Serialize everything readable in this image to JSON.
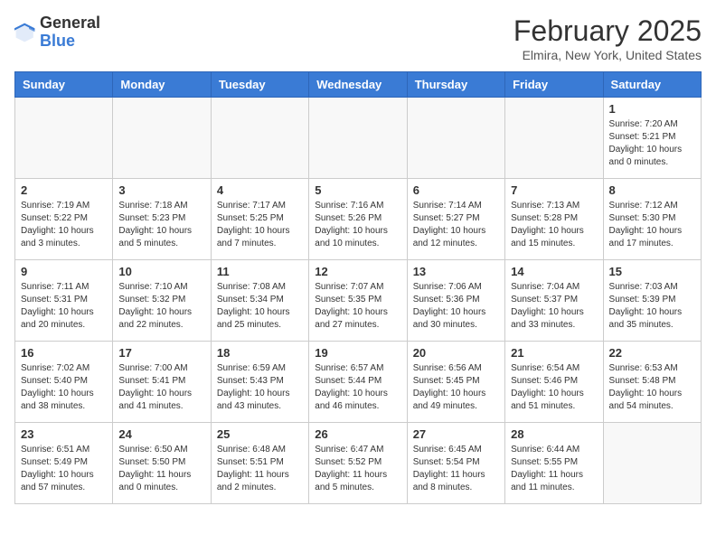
{
  "header": {
    "logo_general": "General",
    "logo_blue": "Blue",
    "title": "February 2025",
    "subtitle": "Elmira, New York, United States"
  },
  "weekdays": [
    "Sunday",
    "Monday",
    "Tuesday",
    "Wednesday",
    "Thursday",
    "Friday",
    "Saturday"
  ],
  "weeks": [
    [
      {
        "day": "",
        "info": ""
      },
      {
        "day": "",
        "info": ""
      },
      {
        "day": "",
        "info": ""
      },
      {
        "day": "",
        "info": ""
      },
      {
        "day": "",
        "info": ""
      },
      {
        "day": "",
        "info": ""
      },
      {
        "day": "1",
        "info": "Sunrise: 7:20 AM\nSunset: 5:21 PM\nDaylight: 10 hours\nand 0 minutes."
      }
    ],
    [
      {
        "day": "2",
        "info": "Sunrise: 7:19 AM\nSunset: 5:22 PM\nDaylight: 10 hours\nand 3 minutes."
      },
      {
        "day": "3",
        "info": "Sunrise: 7:18 AM\nSunset: 5:23 PM\nDaylight: 10 hours\nand 5 minutes."
      },
      {
        "day": "4",
        "info": "Sunrise: 7:17 AM\nSunset: 5:25 PM\nDaylight: 10 hours\nand 7 minutes."
      },
      {
        "day": "5",
        "info": "Sunrise: 7:16 AM\nSunset: 5:26 PM\nDaylight: 10 hours\nand 10 minutes."
      },
      {
        "day": "6",
        "info": "Sunrise: 7:14 AM\nSunset: 5:27 PM\nDaylight: 10 hours\nand 12 minutes."
      },
      {
        "day": "7",
        "info": "Sunrise: 7:13 AM\nSunset: 5:28 PM\nDaylight: 10 hours\nand 15 minutes."
      },
      {
        "day": "8",
        "info": "Sunrise: 7:12 AM\nSunset: 5:30 PM\nDaylight: 10 hours\nand 17 minutes."
      }
    ],
    [
      {
        "day": "9",
        "info": "Sunrise: 7:11 AM\nSunset: 5:31 PM\nDaylight: 10 hours\nand 20 minutes."
      },
      {
        "day": "10",
        "info": "Sunrise: 7:10 AM\nSunset: 5:32 PM\nDaylight: 10 hours\nand 22 minutes."
      },
      {
        "day": "11",
        "info": "Sunrise: 7:08 AM\nSunset: 5:34 PM\nDaylight: 10 hours\nand 25 minutes."
      },
      {
        "day": "12",
        "info": "Sunrise: 7:07 AM\nSunset: 5:35 PM\nDaylight: 10 hours\nand 27 minutes."
      },
      {
        "day": "13",
        "info": "Sunrise: 7:06 AM\nSunset: 5:36 PM\nDaylight: 10 hours\nand 30 minutes."
      },
      {
        "day": "14",
        "info": "Sunrise: 7:04 AM\nSunset: 5:37 PM\nDaylight: 10 hours\nand 33 minutes."
      },
      {
        "day": "15",
        "info": "Sunrise: 7:03 AM\nSunset: 5:39 PM\nDaylight: 10 hours\nand 35 minutes."
      }
    ],
    [
      {
        "day": "16",
        "info": "Sunrise: 7:02 AM\nSunset: 5:40 PM\nDaylight: 10 hours\nand 38 minutes."
      },
      {
        "day": "17",
        "info": "Sunrise: 7:00 AM\nSunset: 5:41 PM\nDaylight: 10 hours\nand 41 minutes."
      },
      {
        "day": "18",
        "info": "Sunrise: 6:59 AM\nSunset: 5:43 PM\nDaylight: 10 hours\nand 43 minutes."
      },
      {
        "day": "19",
        "info": "Sunrise: 6:57 AM\nSunset: 5:44 PM\nDaylight: 10 hours\nand 46 minutes."
      },
      {
        "day": "20",
        "info": "Sunrise: 6:56 AM\nSunset: 5:45 PM\nDaylight: 10 hours\nand 49 minutes."
      },
      {
        "day": "21",
        "info": "Sunrise: 6:54 AM\nSunset: 5:46 PM\nDaylight: 10 hours\nand 51 minutes."
      },
      {
        "day": "22",
        "info": "Sunrise: 6:53 AM\nSunset: 5:48 PM\nDaylight: 10 hours\nand 54 minutes."
      }
    ],
    [
      {
        "day": "23",
        "info": "Sunrise: 6:51 AM\nSunset: 5:49 PM\nDaylight: 10 hours\nand 57 minutes."
      },
      {
        "day": "24",
        "info": "Sunrise: 6:50 AM\nSunset: 5:50 PM\nDaylight: 11 hours\nand 0 minutes."
      },
      {
        "day": "25",
        "info": "Sunrise: 6:48 AM\nSunset: 5:51 PM\nDaylight: 11 hours\nand 2 minutes."
      },
      {
        "day": "26",
        "info": "Sunrise: 6:47 AM\nSunset: 5:52 PM\nDaylight: 11 hours\nand 5 minutes."
      },
      {
        "day": "27",
        "info": "Sunrise: 6:45 AM\nSunset: 5:54 PM\nDaylight: 11 hours\nand 8 minutes."
      },
      {
        "day": "28",
        "info": "Sunrise: 6:44 AM\nSunset: 5:55 PM\nDaylight: 11 hours\nand 11 minutes."
      },
      {
        "day": "",
        "info": ""
      }
    ]
  ]
}
